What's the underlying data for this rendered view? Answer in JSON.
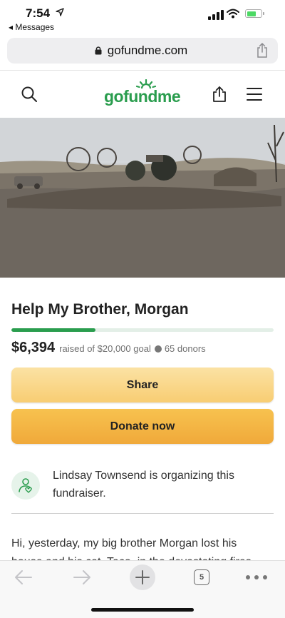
{
  "status_bar": {
    "time": "7:54",
    "back_app": "◂ Messages",
    "battery_level": 0.7
  },
  "browser": {
    "url": "gofundme.com"
  },
  "site": {
    "logo_text": "gofundme"
  },
  "campaign": {
    "title": "Help My Brother, Morgan",
    "amount_raised": "$6,394",
    "goal_text": "raised of $20,000 goal",
    "donors_text": "65 donors",
    "progress_fraction": 0.32,
    "share_label": "Share",
    "donate_label": "Donate now",
    "organizer_text": "Lindsay Townsend is organizing this fundraiser.",
    "story_text": "Hi, yesterday, my big brother Morgan lost his house and his cat, Taco, in the devastating fires"
  },
  "toolbar": {
    "tab_count": "5"
  },
  "colors": {
    "brand_green": "#2a9d4e",
    "share_button": "#f8cd73",
    "donate_button": "#f0a93a"
  },
  "icons": [
    "location-arrow-icon",
    "signal-icon",
    "wifi-icon",
    "battery-icon",
    "lock-icon",
    "share-icon",
    "search-icon",
    "menu-icon",
    "user-heart-icon",
    "back-arrow-icon",
    "forward-arrow-icon",
    "plus-icon",
    "tabs-icon",
    "more-icon"
  ]
}
